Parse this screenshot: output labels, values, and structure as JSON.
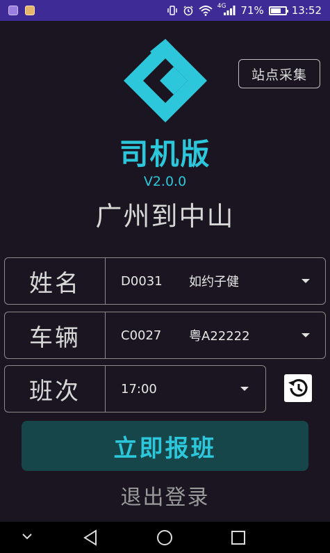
{
  "status_bar": {
    "battery_percent": "71%",
    "battery_level": 0.71,
    "time": "13:52",
    "network": "4G",
    "icons": [
      "gallery-icon",
      "app-icon",
      "vibrate-icon",
      "alarm-icon",
      "wifi-icon",
      "signal-icon",
      "battery-icon"
    ]
  },
  "header": {
    "collect_button": "站点采集",
    "logo_icon": "diamond-logo-icon"
  },
  "title": {
    "app_name": "司机版",
    "version": "V2.0.0",
    "route": "广州到中山"
  },
  "form": {
    "name": {
      "label": "姓名",
      "code": "D0031",
      "value": "如约子健"
    },
    "vehicle": {
      "label": "车辆",
      "code": "C0027",
      "value": "粤A22222"
    },
    "shift": {
      "label": "班次",
      "value": "17:00"
    }
  },
  "actions": {
    "submit": "立即报班",
    "logout": "退出登录",
    "history_icon": "history-icon"
  },
  "nav": {
    "icons": [
      "chevron-down-icon",
      "back-icon",
      "home-icon",
      "recents-icon"
    ]
  },
  "colors": {
    "accent": "#2cc7da",
    "status_bar": "#3e2b95",
    "background": "#1a1521",
    "submit_bg": "#17464a"
  }
}
